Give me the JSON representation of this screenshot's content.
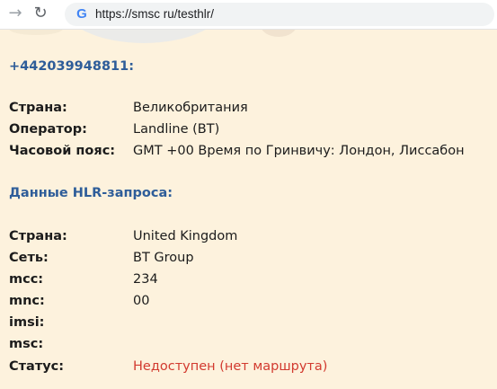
{
  "browser": {
    "url": "https://smsc ru/testhlr/",
    "back_icon": "arrow-back-icon",
    "reload_icon": "reload-icon",
    "site_icon": "google-g-icon"
  },
  "phone": "+442039948811:",
  "info": {
    "country_label": "Страна:",
    "country_value": "Великобритания",
    "operator_label": "Оператор:",
    "operator_value": "Landline (BT)",
    "tz_label": "Часовой пояс:",
    "tz_value": "GMT +00 Время по Гринвичу: Лондон, Лиссабон"
  },
  "hlr": {
    "heading": "Данные HLR-запроса:",
    "country_label": "Страна:",
    "country_value": "United Kingdom",
    "network_label": "Сеть:",
    "network_value": "BT Group",
    "mcc_label": "mcc:",
    "mcc_value": "234",
    "mnc_label": "mnc:",
    "mnc_value": "00",
    "imsi_label": "imsi:",
    "msc_label": "msc:",
    "status_label": "Статус:",
    "status_value": "Недоступен (нет маршрута)"
  },
  "colors": {
    "page_bg": "#fdf2dd",
    "heading": "#2e5d99",
    "status_error": "#d23a2f"
  }
}
